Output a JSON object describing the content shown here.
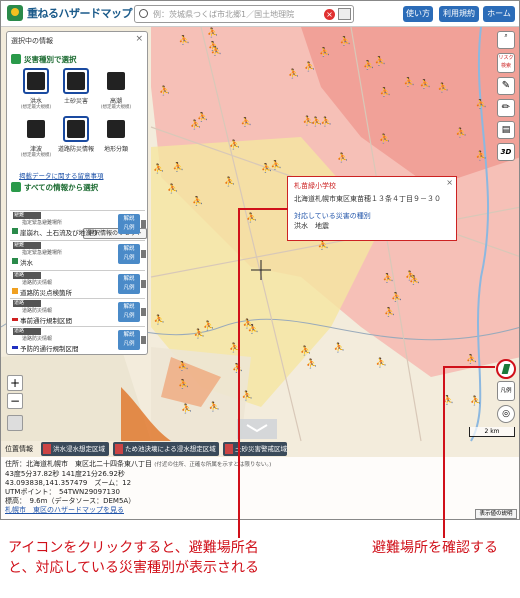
{
  "header": {
    "title": "重ねるハザードマップ",
    "search_placeholder": "例：茨城県つくば市北郷1／国土地理院",
    "btn_help": "使い方",
    "btn_terms": "利用規約",
    "btn_home": "ホーム"
  },
  "panel": {
    "title": "選択中の情報",
    "select_by_type": "災害種別で選択",
    "hazards": [
      {
        "label": "洪水",
        "sub": "(想定最大規模)"
      },
      {
        "label": "土砂災害",
        "sub": ""
      },
      {
        "label": "高潮",
        "sub": "(想定最大規模)"
      },
      {
        "label": "津波",
        "sub": "(想定最大規模)"
      },
      {
        "label": "道路防災情報",
        "sub": ""
      },
      {
        "label": "地形分類",
        "sub": ""
      }
    ],
    "disaster_link": "揭載データに関する留意事項",
    "select_all": "すべての情報から選択",
    "reset": "選択情報のリセット",
    "entries": [
      {
        "category": "指定緊急避難場所",
        "name": "崖崩れ、土石流及び地滑り",
        "legend": "解説\n凡例"
      },
      {
        "category": "指定緊急避難場所",
        "name": "洪水",
        "legend": "解説\n凡例"
      },
      {
        "category": "道路防災情報",
        "name": "道路防災点検箇所",
        "legend": "解説\n凡例"
      },
      {
        "category": "道路防災情報",
        "name": "事前通行規制区間",
        "legend": "解説\n凡例"
      },
      {
        "category": "道路防災情報",
        "name": "予防的通行規制区間",
        "legend": "解説\n凡例"
      }
    ],
    "entry_tags": [
      "避難",
      "避難",
      "道路",
      "道路",
      "道路"
    ]
  },
  "right_tools": {
    "risk_label": "リスク\n検索",
    "three_d": "3D",
    "legend": "凡例"
  },
  "popup": {
    "name": "札苗緑小学校",
    "address": "北海道札幌市東区東苗穂１３条４丁目９－３０",
    "hazard_heading": "対応している災害の種別",
    "hazards": "洪水　地震"
  },
  "scale": "2 km",
  "layerbar": {
    "label": "位置情報",
    "buttons": [
      "洪水浸水想定区域",
      "ため池決壊による浸水想定区域",
      "土砂災害警戒区域"
    ]
  },
  "info": {
    "address_line": "住所：北海道札幌市　東区北二十四条東八丁目",
    "address_note": "(付近の住所、正確な所属を示すとは限りない。)",
    "latlon_dms": "43度5分37.82秒 141度21分26.92秒",
    "latlon_dec": "43.093838,141.357479　ズーム：12",
    "utm": "UTMポイント：　54TWN29097130",
    "elevation": "標高：　9.6m（データソース：DEM5A）",
    "link": "札幌市　東区のハザードマップを見る"
  },
  "explain_button": "表示値の説明",
  "captions": {
    "left_line1": "アイコンをクリックすると、避難場所名",
    "left_line2": "と、対応している災害種別が表示される",
    "right": "避難場所を確認する"
  },
  "colors": {
    "accent_red": "#d0101a",
    "header_blue": "#2b6cb8",
    "shelter_green": "#1a7a3a",
    "flood_pink": "#f4b4b0",
    "flood_yellow": "#f6e8a0"
  }
}
